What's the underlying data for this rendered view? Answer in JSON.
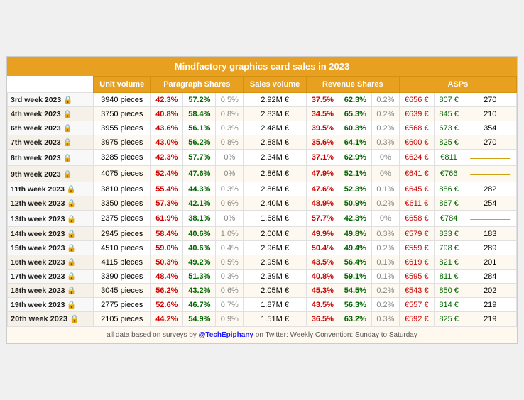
{
  "title": "Mindfactory graphics card sales in 2023",
  "headers": [
    "",
    "Unit volume",
    "Paragraph Shares",
    "Sales volume",
    "Revenue Shares",
    "ASPs"
  ],
  "rows": [
    {
      "week": "3rd week 2023 🔒",
      "bold": false,
      "unit_volume": "3940 pieces",
      "para1": "42.3%",
      "para1_color": "red",
      "para2": "57.2%",
      "para2_color": "green",
      "para3": "0.5%",
      "para3_color": "gray",
      "sales_volume": "2.92M €",
      "rev1": "37.5%",
      "rev1_color": "red",
      "rev2": "62.3%",
      "rev2_color": "green",
      "rev3": "0.2%",
      "rev3_color": "gray",
      "asp1": "€656 €",
      "asp2": "807 €",
      "asp3": "270"
    },
    {
      "week": "4th week 2023 🔒",
      "bold": false,
      "unit_volume": "3750 pieces",
      "para1": "40.8%",
      "para1_color": "red",
      "para2": "58.4%",
      "para2_color": "green",
      "para3": "0.8%",
      "para3_color": "gray",
      "sales_volume": "2.83M €",
      "rev1": "34.5%",
      "rev1_color": "red",
      "rev2": "65.3%",
      "rev2_color": "green",
      "rev3": "0.2%",
      "rev3_color": "gray",
      "asp1": "€639 €",
      "asp2": "845 €",
      "asp3": "210"
    },
    {
      "week": "6th week 2023 🔒",
      "bold": false,
      "unit_volume": "3955 pieces",
      "para1": "43.6%",
      "para1_color": "red",
      "para2": "56.1%",
      "para2_color": "green",
      "para3": "0.3%",
      "para3_color": "gray",
      "sales_volume": "2.48M €",
      "rev1": "39.5%",
      "rev1_color": "red",
      "rev2": "60.3%",
      "rev2_color": "green",
      "rev3": "0.2%",
      "rev3_color": "gray",
      "asp1": "€568 €",
      "asp2": "673 €",
      "asp3": "354"
    },
    {
      "week": "7th week 2023 🔒",
      "bold": false,
      "unit_volume": "3975 pieces",
      "para1": "43.0%",
      "para1_color": "red",
      "para2": "56.2%",
      "para2_color": "green",
      "para3": "0.8%",
      "para3_color": "gray",
      "sales_volume": "2.88M €",
      "rev1": "35.6%",
      "rev1_color": "red",
      "rev2": "64.1%",
      "rev2_color": "green",
      "rev3": "0.3%",
      "rev3_color": "gray",
      "asp1": "€600 €",
      "asp2": "825 €",
      "asp3": "270"
    },
    {
      "week": "8th week 2023 🔒",
      "bold": false,
      "unit_volume": "3285 pieces",
      "para1": "42.3%",
      "para1_color": "red",
      "para2": "57.7%",
      "para2_color": "green",
      "para3": "0%",
      "para3_color": "gray",
      "sales_volume": "2.34M €",
      "rev1": "37.1%",
      "rev1_color": "red",
      "rev2": "62.9%",
      "rev2_color": "green",
      "rev3": "0%",
      "rev3_color": "gray",
      "asp1": "€624 €",
      "asp2": "€811",
      "asp3": "—"
    },
    {
      "week": "9th week 2023 🔒",
      "bold": false,
      "unit_volume": "4075 pieces",
      "para1": "52.4%",
      "para1_color": "red",
      "para2": "47.6%",
      "para2_color": "green",
      "para3": "0%",
      "para3_color": "gray",
      "sales_volume": "2.86M €",
      "rev1": "47.9%",
      "rev1_color": "red",
      "rev2": "52.1%",
      "rev2_color": "green",
      "rev3": "0%",
      "rev3_color": "gray",
      "asp1": "€641 €",
      "asp2": "€766",
      "asp3": "—"
    },
    {
      "week": "11th week 2023 🔒",
      "bold": false,
      "unit_volume": "3810 pieces",
      "para1": "55.4%",
      "para1_color": "red",
      "para2": "44.3%",
      "para2_color": "green",
      "para3": "0.3%",
      "para3_color": "gray",
      "sales_volume": "2.86M €",
      "rev1": "47.6%",
      "rev1_color": "red",
      "rev2": "52.3%",
      "rev2_color": "green",
      "rev3": "0.1%",
      "rev3_color": "gray",
      "asp1": "€645 €",
      "asp2": "886 €",
      "asp3": "282"
    },
    {
      "week": "12th week 2023 🔒",
      "bold": false,
      "unit_volume": "3350 pieces",
      "para1": "57.3%",
      "para1_color": "red",
      "para2": "42.1%",
      "para2_color": "green",
      "para3": "0.6%",
      "para3_color": "gray",
      "sales_volume": "2.40M €",
      "rev1": "48.9%",
      "rev1_color": "red",
      "rev2": "50.9%",
      "rev2_color": "green",
      "rev3": "0.2%",
      "rev3_color": "gray",
      "asp1": "€611 €",
      "asp2": "867 €",
      "asp3": "254"
    },
    {
      "week": "13th week 2023 🔒",
      "bold": false,
      "unit_volume": "2375 pieces",
      "para1": "61.9%",
      "para1_color": "red",
      "para2": "38.1%",
      "para2_color": "green",
      "para3": "0%",
      "para3_color": "gray",
      "sales_volume": "1.68M €",
      "rev1": "57.7%",
      "rev1_color": "red",
      "rev2": "42.3%",
      "rev2_color": "green",
      "rev3": "0%",
      "rev3_color": "gray",
      "asp1": "€658 €",
      "asp2": "€784",
      "asp3": "—"
    },
    {
      "week": "14th week 2023 🔒",
      "bold": false,
      "unit_volume": "2945 pieces",
      "para1": "58.4%",
      "para1_color": "red",
      "para2": "40.6%",
      "para2_color": "green",
      "para3": "1.0%",
      "para3_color": "gray",
      "sales_volume": "2.00M €",
      "rev1": "49.9%",
      "rev1_color": "red",
      "rev2": "49.8%",
      "rev2_color": "green",
      "rev3": "0.3%",
      "rev3_color": "gray",
      "asp1": "€579 €",
      "asp2": "833 €",
      "asp3": "183"
    },
    {
      "week": "15th week 2023 🔒",
      "bold": false,
      "unit_volume": "4510 pieces",
      "para1": "59.0%",
      "para1_color": "red",
      "para2": "40.6%",
      "para2_color": "green",
      "para3": "0.4%",
      "para3_color": "gray",
      "sales_volume": "2.96M €",
      "rev1": "50.4%",
      "rev1_color": "red",
      "rev2": "49.4%",
      "rev2_color": "green",
      "rev3": "0.2%",
      "rev3_color": "gray",
      "asp1": "€559 €",
      "asp2": "798 €",
      "asp3": "289"
    },
    {
      "week": "16th week 2023 🔒",
      "bold": false,
      "unit_volume": "4115 pieces",
      "para1": "50.3%",
      "para1_color": "red",
      "para2": "49.2%",
      "para2_color": "green",
      "para3": "0.5%",
      "para3_color": "gray",
      "sales_volume": "2.95M €",
      "rev1": "43.5%",
      "rev1_color": "red",
      "rev2": "56.4%",
      "rev2_color": "green",
      "rev3": "0.1%",
      "rev3_color": "gray",
      "asp1": "€619 €",
      "asp2": "821 €",
      "asp3": "201"
    },
    {
      "week": "17th week 2023 🔒",
      "bold": false,
      "unit_volume": "3390 pieces",
      "para1": "48.4%",
      "para1_color": "red",
      "para2": "51.3%",
      "para2_color": "green",
      "para3": "0.3%",
      "para3_color": "gray",
      "sales_volume": "2.39M €",
      "rev1": "40.8%",
      "rev1_color": "red",
      "rev2": "59.1%",
      "rev2_color": "green",
      "rev3": "0.1%",
      "rev3_color": "gray",
      "asp1": "€595 €",
      "asp2": "811 €",
      "asp3": "284"
    },
    {
      "week": "18th week 2023 🔒",
      "bold": false,
      "unit_volume": "3045 pieces",
      "para1": "56.2%",
      "para1_color": "red",
      "para2": "43.2%",
      "para2_color": "green",
      "para3": "0.6%",
      "para3_color": "gray",
      "sales_volume": "2.05M €",
      "rev1": "45.3%",
      "rev1_color": "red",
      "rev2": "54.5%",
      "rev2_color": "green",
      "rev3": "0.2%",
      "rev3_color": "gray",
      "asp1": "€543 €",
      "asp2": "850 €",
      "asp3": "202"
    },
    {
      "week": "19th week 2023 🔒",
      "bold": false,
      "unit_volume": "2775 pieces",
      "para1": "52.6%",
      "para1_color": "red",
      "para2": "46.7%",
      "para2_color": "green",
      "para3": "0.7%",
      "para3_color": "gray",
      "sales_volume": "1.87M €",
      "rev1": "43.5%",
      "rev1_color": "red",
      "rev2": "56.3%",
      "rev2_color": "green",
      "rev3": "0.2%",
      "rev3_color": "gray",
      "asp1": "€557 €",
      "asp2": "814 €",
      "asp3": "219"
    },
    {
      "week": "20th week 2023 🔒",
      "bold": true,
      "unit_volume": "2105 pieces",
      "para1": "44.2%",
      "para1_color": "red",
      "para2": "54.9%",
      "para2_color": "green",
      "para3": "0.9%",
      "para3_color": "gray",
      "sales_volume": "1.51M €",
      "rev1": "36.5%",
      "rev1_color": "red",
      "rev2": "63.2%",
      "rev2_color": "green",
      "rev3": "0.3%",
      "rev3_color": "gray",
      "asp1": "€592 €",
      "asp2": "825 €",
      "asp3": "219"
    }
  ],
  "footer": "all data based on surveys by @TechEpiphany on Twitter: Weekly Convention: Sunday to Saturday"
}
